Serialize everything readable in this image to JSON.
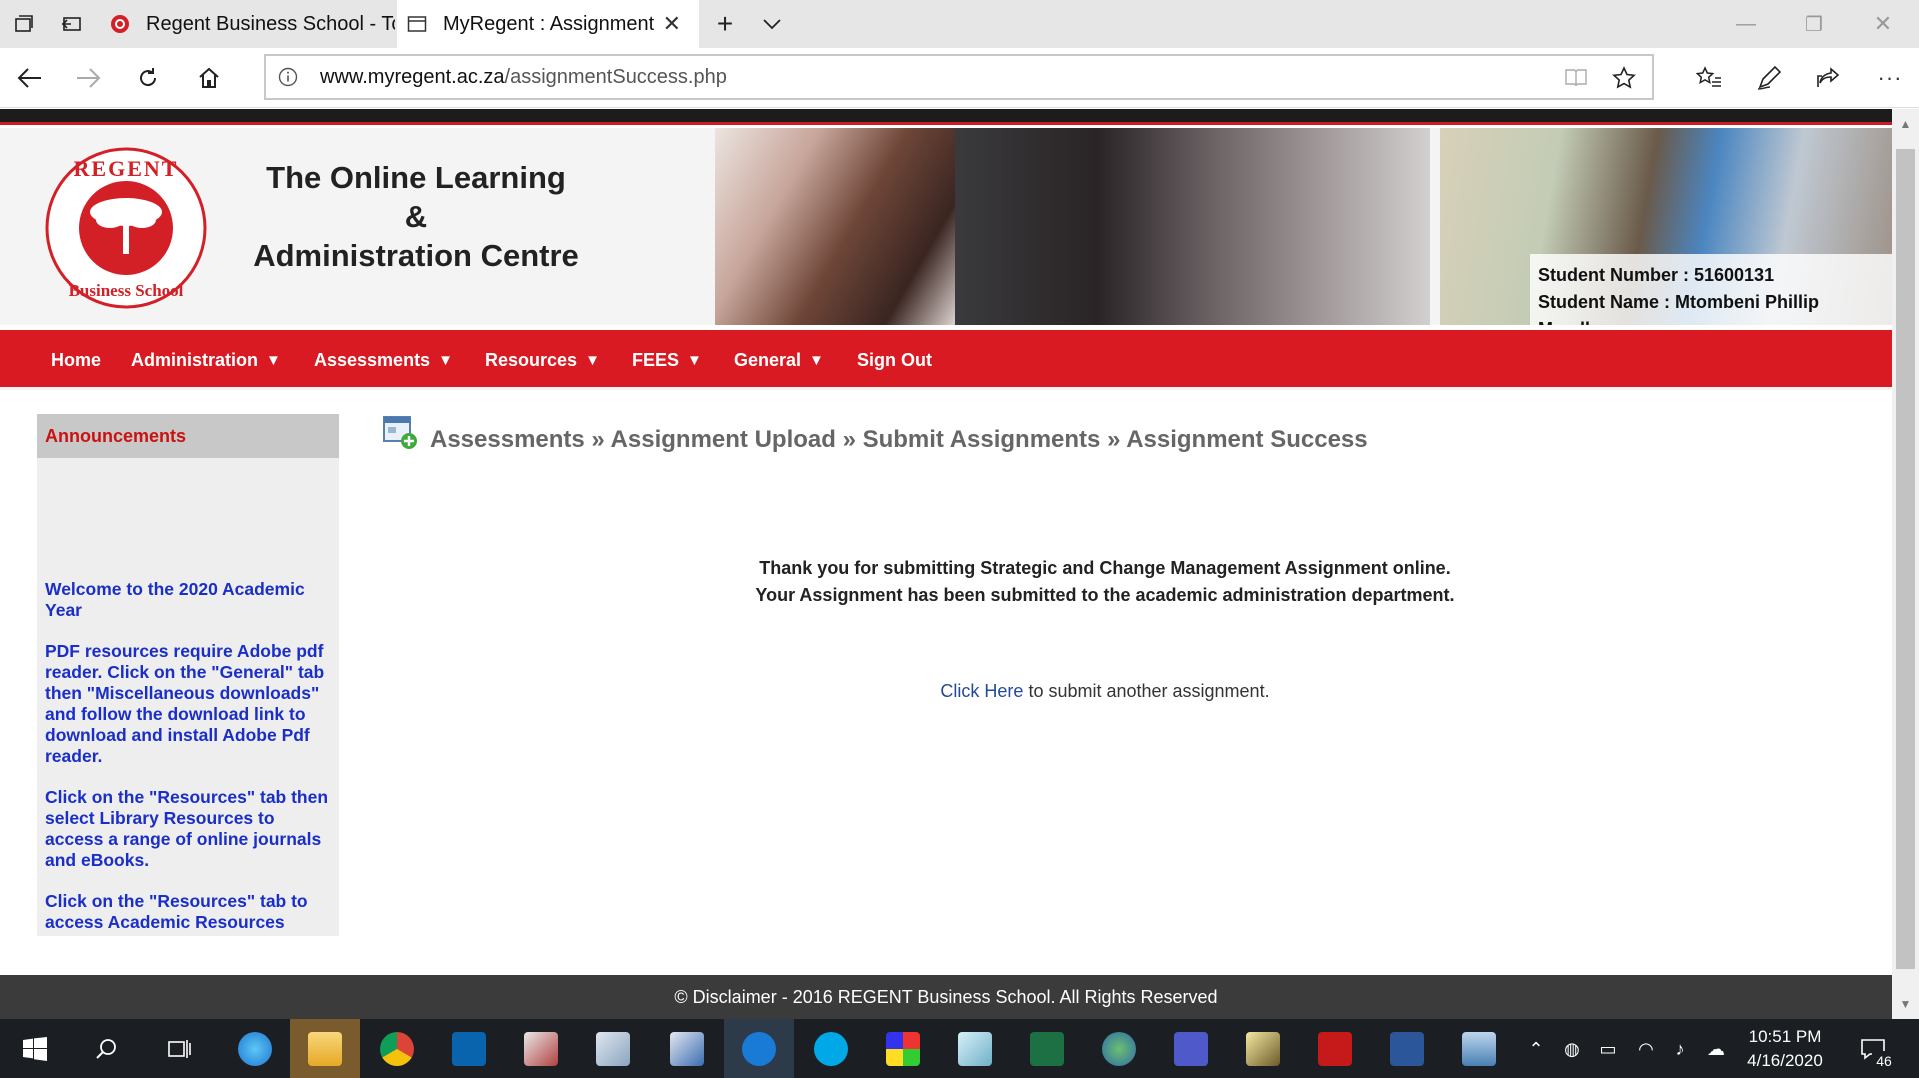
{
  "browser": {
    "tabs": [
      {
        "title": "Regent Business School - Tc",
        "active": false
      },
      {
        "title": "MyRegent : Assignment",
        "active": true
      }
    ],
    "url_domain": "www.myregent.ac.za",
    "url_path": "/assignmentSuccess.php"
  },
  "header": {
    "logo_text_top": "REGENT",
    "logo_text_bottom": "Business School",
    "title_line1": "The Online Learning",
    "title_line2": "&",
    "title_line3": "Administration Centre",
    "student_number": "Student Number : 51600131",
    "student_name": "Student Name : Mtombeni Phillip Mandla"
  },
  "menu": {
    "home": "Home",
    "administration": "Administration",
    "assessments": "Assessments",
    "resources": "Resources",
    "fees": "FEES",
    "general": "General",
    "sign_out": "Sign Out",
    "dropdown_arrow": "▼"
  },
  "announcements": {
    "heading": "Announcements",
    "items": [
      "Welcome to the 2020 Academic Year",
      "PDF resources require Adobe pdf reader. Click on the \"General\" tab then \"Miscellaneous downloads\" and follow the download link to download and install Adobe Pdf reader.",
      "Click on the \"Resources\" tab then select Library Resources to access a range of online journals and eBooks.",
      "Click on the \"Resources\" tab to access Academic Resources"
    ]
  },
  "breadcrumb": "Assessments » Assignment Upload » Submit Assignments » Assignment Success",
  "message": {
    "line1": "Thank you for submitting Strategic and Change Management Assignment online.",
    "line2": "Your Assignment has been submitted to the academic administration department.",
    "link": "Click Here",
    "after_link": " to submit another assignment."
  },
  "footer": "© Disclaimer - 2016 REGENT Business School. All Rights Reserved",
  "taskbar": {
    "time": "10:51 PM",
    "date": "4/16/2020",
    "notification_count": "46"
  },
  "colors": {
    "brand_red": "#d91a22",
    "link_blue": "#1a2ec8",
    "footer_bg": "#3b3b3b"
  }
}
